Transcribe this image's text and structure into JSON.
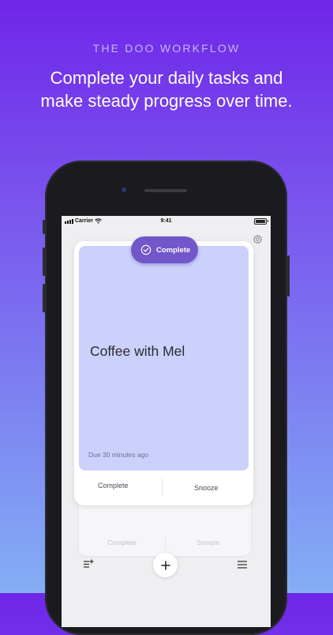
{
  "promo": {
    "eyebrow": "THE DOO WORKFLOW",
    "headline_line1": "Complete your daily tasks and",
    "headline_line2": "make steady progress over time."
  },
  "status_bar": {
    "carrier": "Carrier",
    "time": "9:41"
  },
  "task_card": {
    "title": "Coffee with Mel",
    "due": "Due 30 minutes ago",
    "badge_label": "Complete",
    "actions": [
      "Complete",
      "Snooze"
    ]
  },
  "back_card": {
    "actions": [
      "Complete",
      "Snooze"
    ]
  },
  "icons": {
    "settings": "gear-icon",
    "badge": "check-circle-icon",
    "add": "plus-icon",
    "filter": "sort-add-icon",
    "menu": "hamburger-icon"
  },
  "colors": {
    "background_top": "#6f26e8",
    "background_bottom": "#84aef5",
    "card_face": "#ccd1fb",
    "badge": "#7157c9"
  }
}
